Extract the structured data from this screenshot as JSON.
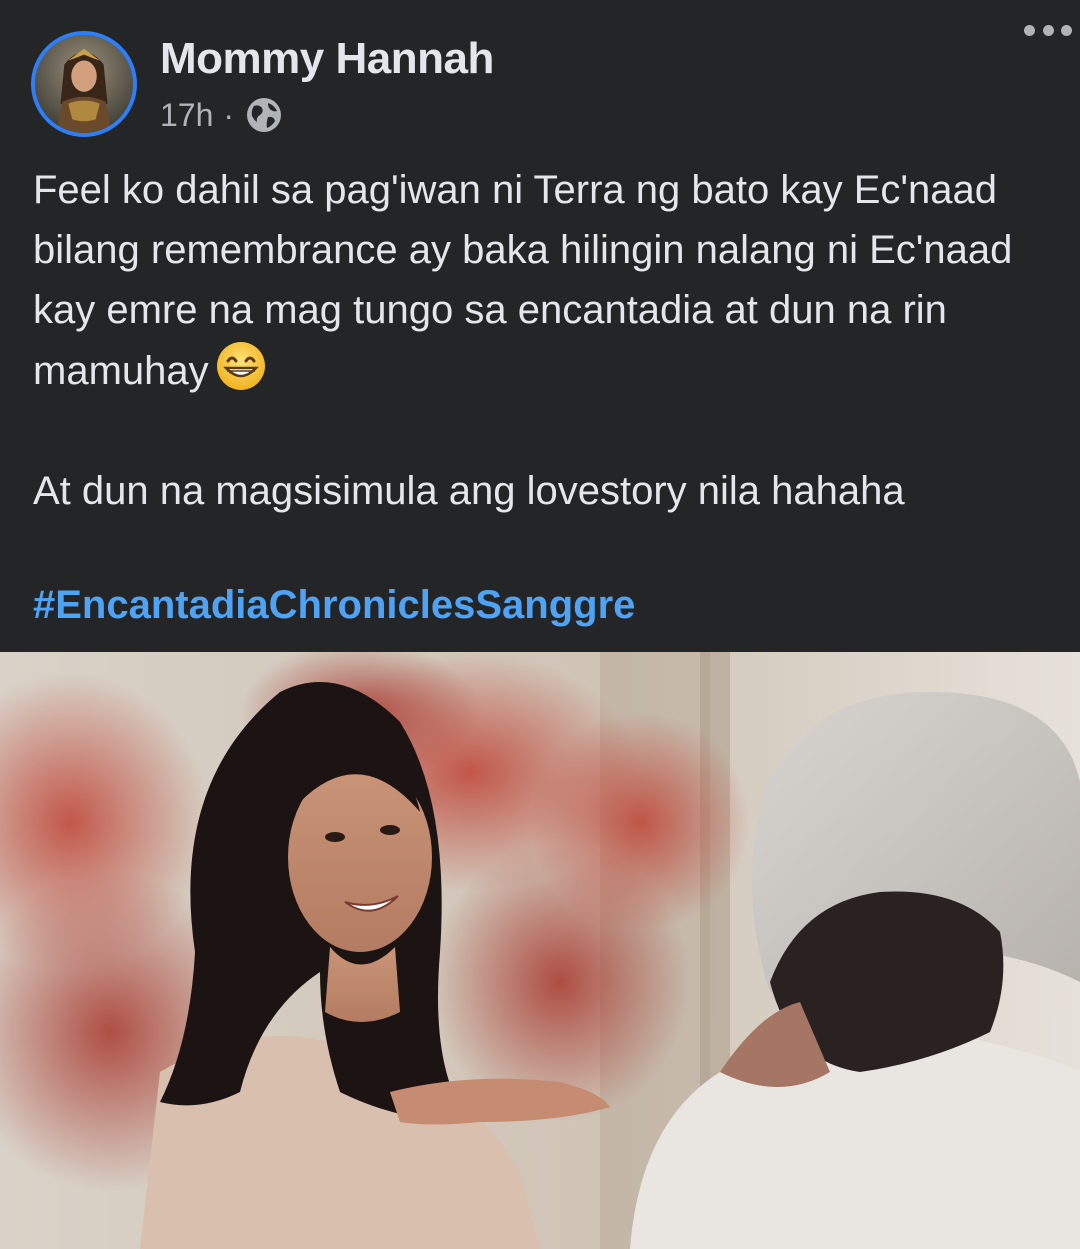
{
  "post": {
    "author": "Mommy Hannah",
    "time": "17h",
    "separator": "·",
    "privacy_icon": "globe-icon",
    "menu_icon": "more-options-icon",
    "body_paragraphs": [
      "Feel ko dahil sa pag'iwan ni Terra ng bato kay Ec'naad bilang remembrance ay baka hilingin nalang ni Ec'naad kay emre na mag tungo sa encantadia at dun na rin mamuhay",
      "At dun na magsisimula ang lovestory nila hahaha"
    ],
    "emoji": "grinning-face-emoji",
    "hashtag": "#EncantadiaChroniclesSanggre",
    "colors": {
      "background": "#242526",
      "text": "#e4e6eb",
      "secondary_text": "#b0b3b8",
      "link": "#4ea3f5",
      "avatar_ring": "#2d7ff9"
    }
  }
}
